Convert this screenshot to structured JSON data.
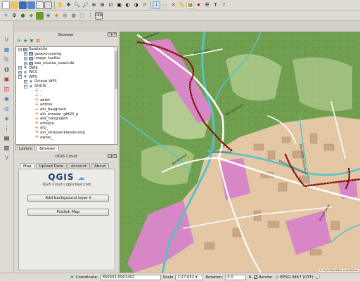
{
  "toolbar_top": [
    "new-project",
    "open-project",
    "save-project",
    "save-as",
    "print-composer",
    "composer-manager",
    "pan",
    "pan-to-selection",
    "zoom-in",
    "zoom-out",
    "zoom-actual",
    "zoom-full",
    "zoom-layer",
    "zoom-selection",
    "zoom-last",
    "zoom-next",
    "refresh",
    "identify",
    "select",
    "deselect",
    "measure",
    "map-tips",
    "new-bookmark",
    "show-bookmarks",
    "text-annotation",
    "help"
  ],
  "browser": {
    "title": "Browser",
    "items": [
      {
        "depth": 0,
        "expander": "minus",
        "icon": "db",
        "label": "SpatiaLite"
      },
      {
        "depth": 1,
        "expander": "plus",
        "icon": "db",
        "label": "geoprocessing"
      },
      {
        "depth": 1,
        "expander": "plus",
        "icon": "db",
        "label": "image_tooltip"
      },
      {
        "depth": 1,
        "expander": "plus",
        "icon": "db",
        "label": "sao_nicolou_coast.db"
      },
      {
        "depth": 0,
        "expander": "plus",
        "icon": "globe",
        "label": "OWS"
      },
      {
        "depth": 0,
        "expander": "plus",
        "icon": "globe",
        "label": "WCS"
      },
      {
        "depth": 0,
        "expander": "minus",
        "icon": "globe",
        "label": "WFS"
      },
      {
        "depth": 1,
        "expander": "plus",
        "icon": "globe",
        "label": "Qcloud WFS"
      },
      {
        "depth": 1,
        "expander": "minus",
        "icon": "globe",
        "label": "SOGIS"
      },
      {
        "depth": 2,
        "expander": "",
        "icon": "layer",
        "label": "-"
      },
      {
        "depth": 2,
        "expander": "",
        "icon": "layer",
        "label": "-"
      },
      {
        "depth": 2,
        "expander": "",
        "icon": "layer",
        "label": "abrkt"
      },
      {
        "depth": 2,
        "expander": "",
        "icon": "layer",
        "label": "adress"
      },
      {
        "depth": 2,
        "expander": "",
        "icon": "layer",
        "label": "afu_baugrund"
      },
      {
        "depth": 2,
        "expander": "",
        "icon": "layer",
        "label": "afu_erosion_gbf20_p"
      },
      {
        "depth": 2,
        "expander": "",
        "icon": "layer",
        "label": "alw_hanglagen"
      },
      {
        "depth": 2,
        "expander": "",
        "icon": "layer",
        "label": "artsipla"
      },
      {
        "depth": 2,
        "expander": "",
        "icon": "layer",
        "label": "arp_"
      },
      {
        "depth": 2,
        "expander": "",
        "icon": "layer",
        "label": "avt_strassenklassierung"
      },
      {
        "depth": 2,
        "expander": "",
        "icon": "layer",
        "label": "awew_"
      }
    ]
  },
  "dock_tabs": [
    "Layers",
    "Browser"
  ],
  "cloud": {
    "title": "QGIS Cloud",
    "tabs": [
      "Map",
      "Upload Data",
      "Account",
      "About"
    ],
    "logo_text": "QGIS",
    "slogan": "QGIS Cloud | qgiscloud.com",
    "add_background_label": "Add background layer",
    "publish_label": "Publish Map"
  },
  "map": {
    "attribution": "© OpenStreetMap contributors",
    "street_labels": [
      "Hauptgasse",
      "Rötistrasse",
      "Wengistrasse",
      "Bielstrasse",
      "Baselstrasse",
      "Weissensteinstrasse",
      "Dornacherstrasse",
      "Bergstrasse"
    ]
  },
  "status": {
    "coordinate_label": "Coordinate:",
    "coordinate_value": "856401,5991402",
    "scale_label": "Scale",
    "scale_value": "1:17,652",
    "rotation_label": "Rotation:",
    "rotation_value": "0.0",
    "render_label": "Render",
    "crs_label": "EPSG:3857 (OTF)"
  },
  "colors": {
    "urban": "#e5c8a6",
    "commercial": "#d787c6",
    "forest": "#6f9f4f",
    "river": "#56c3c9",
    "rail_dots": "#8b1a1a",
    "road": "#ffffff"
  }
}
